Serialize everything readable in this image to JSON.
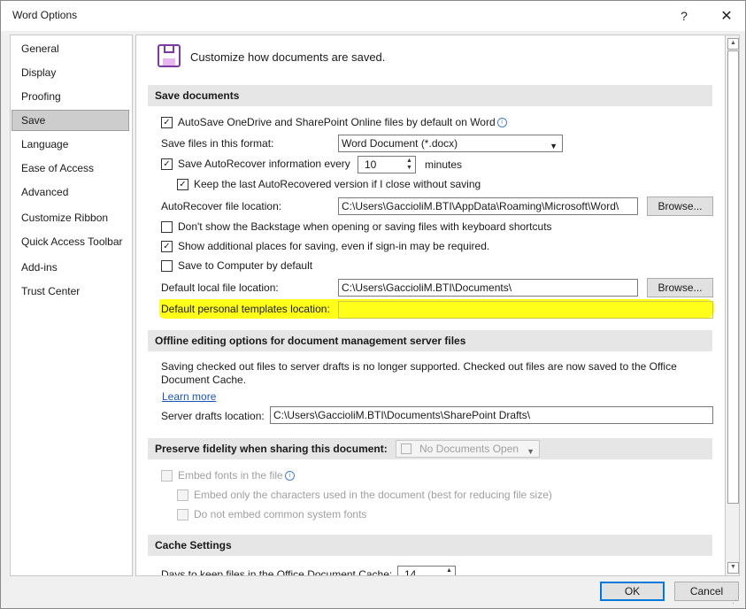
{
  "window": {
    "title": "Word Options",
    "help": "?",
    "close": "✕"
  },
  "sidebar": {
    "items": [
      {
        "label": "General"
      },
      {
        "label": "Display"
      },
      {
        "label": "Proofing"
      },
      {
        "label": "Save",
        "selected": true
      },
      {
        "label": "Language"
      },
      {
        "label": "Ease of Access"
      },
      {
        "label": "Advanced"
      },
      {
        "label": "Customize Ribbon"
      },
      {
        "label": "Quick Access Toolbar"
      },
      {
        "label": "Add-ins"
      },
      {
        "label": "Trust Center"
      }
    ]
  },
  "header": {
    "text": "Customize how documents are saved.",
    "icon": "save-disk-icon"
  },
  "save_documents": {
    "heading": "Save documents",
    "autosave_label": "AutoSave OneDrive and SharePoint Online files by default on Word",
    "format_label": "Save files in this format:",
    "format_value": "Word Document (*.docx)",
    "autorecover_label": "Save AutoRecover information every",
    "autorecover_minutes": "10",
    "minutes_label": "minutes",
    "keep_last_label": "Keep the last AutoRecovered version if I close without saving",
    "autorecover_location_label": "AutoRecover file location:",
    "autorecover_location_value": "C:\\Users\\GaccioliM.BTI\\AppData\\Roaming\\Microsoft\\Word\\",
    "browse_label": "Browse...",
    "no_backstage_label": "Don't show the Backstage when opening or saving files with keyboard shortcuts",
    "show_places_label": "Show additional places for saving, even if sign-in may be required.",
    "save_computer_label": "Save to Computer by default",
    "default_local_label": "Default local file location:",
    "default_local_value": "C:\\Users\\GaccioliM.BTI\\Documents\\",
    "templates_label": "Default personal templates location:",
    "templates_value": ""
  },
  "offline": {
    "heading": "Offline editing options for document management server files",
    "notice_line1": "Saving checked out files to server drafts is no longer supported. Checked out files are now saved to the Office",
    "notice_line2": "Document Cache.",
    "learn_more": "Learn more",
    "drafts_label": "Server drafts location:",
    "drafts_value": "C:\\Users\\GaccioliM.BTI\\Documents\\SharePoint Drafts\\"
  },
  "fidelity": {
    "heading": "Preserve fidelity when sharing this document:",
    "doc_select": "No Documents Open",
    "embed_fonts_label": "Embed fonts in the file",
    "embed_chars_label": "Embed only the characters used in the document (best for reducing file size)",
    "no_common_label": "Do not embed common system fonts"
  },
  "cache": {
    "heading": "Cache Settings",
    "days_label": "Days to keep files in the Office Document Cache:",
    "days_value": "14"
  },
  "footer": {
    "ok": "OK",
    "cancel": "Cancel"
  },
  "colors": {
    "highlight": "#ffff1a",
    "accent": "#0078d7",
    "link": "#1a56b4"
  }
}
